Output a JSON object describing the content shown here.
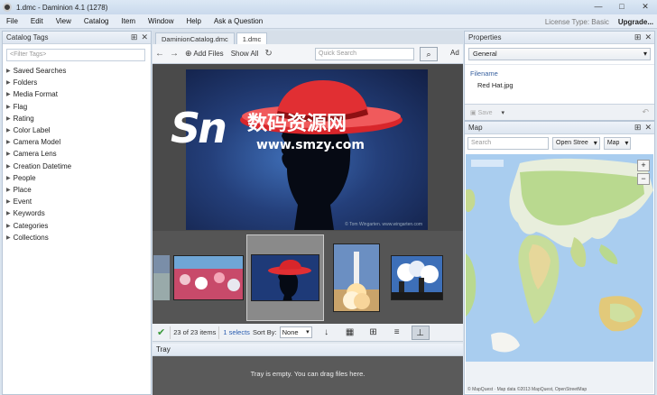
{
  "window": {
    "title": "1.dmc - Daminion 4.1 (1278)",
    "controls": [
      "—",
      "□",
      "✕"
    ]
  },
  "menu": {
    "items": [
      "File",
      "Edit",
      "View",
      "Catalog",
      "Item",
      "Window",
      "Help",
      "Ask a Question"
    ],
    "license": "License Type: Basic",
    "upgrade": "Upgrade..."
  },
  "catalog_tags": {
    "title": "Catalog Tags",
    "filter_placeholder": "<Filter Tags>",
    "items": [
      "Saved Searches",
      "Folders",
      "Media Format",
      "Flag",
      "Rating",
      "Color Label",
      "Camera Model",
      "Camera Lens",
      "Creation Datetime",
      "People",
      "Place",
      "Event",
      "Keywords",
      "Categories",
      "Collections"
    ]
  },
  "center": {
    "tabs": [
      "DaminionCatalog.dmc",
      "1.dmc"
    ],
    "toolbar": {
      "back": "←",
      "forward": "→",
      "add_files": "Add Files",
      "show_all": "Show All",
      "refresh": "↻",
      "quick_search_placeholder": "Quick Search",
      "search_button": "🔍",
      "cut_off": "Ad"
    },
    "photo_credit": "© Tom Wingarten. www.wingarten.com",
    "watermark": {
      "logo": "Sn",
      "chinese": "数码资源网",
      "url": "www.smzy.com"
    },
    "status": {
      "count": "23 of 23 items",
      "selects": "1 selects",
      "sort_by": "Sort By:",
      "sort_value": "None"
    },
    "tray": {
      "title": "Tray",
      "empty_text": "Tray is empty. You can drag files here."
    }
  },
  "properties": {
    "title": "Properties",
    "section": "General",
    "filename_label": "Filename",
    "filename_value": "Red Hat.jpg",
    "save": "Save"
  },
  "map": {
    "title": "Map",
    "search_placeholder": "Search",
    "street_select": "Open Stree",
    "map_select": "Map",
    "zoom_in": "+",
    "zoom_out": "−",
    "attribution": "© MapQuest · Map data ©2013 MapQuest, OpenStreetMap"
  },
  "colors": {
    "accent": "#2a5db0",
    "panel_header": "#dde6f0",
    "viewer_bg": "#4a4a4a",
    "hat_red": "#d8262b"
  }
}
